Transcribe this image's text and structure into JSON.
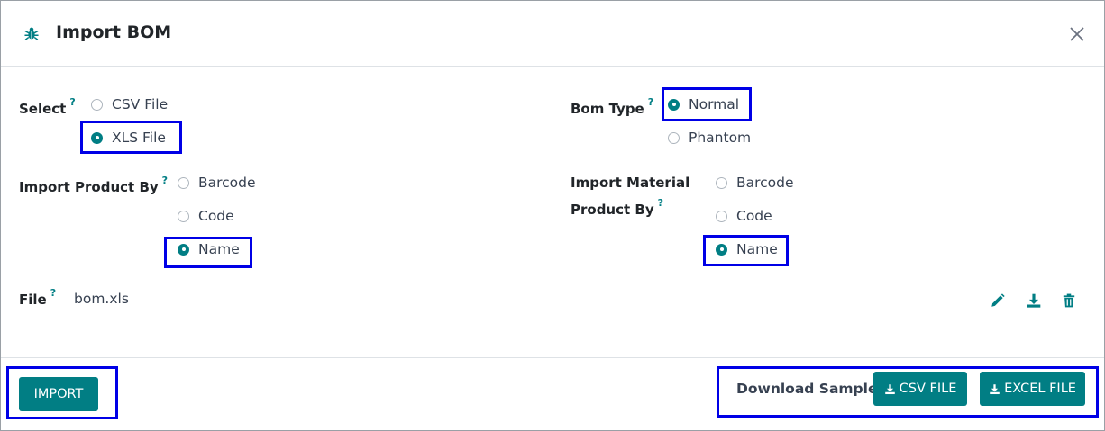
{
  "dialog": {
    "title": "Import BOM",
    "icon": "bug-icon",
    "close_icon": "close-icon"
  },
  "form": {
    "select": {
      "label": "Select",
      "help": "?",
      "options": [
        "CSV File",
        "XLS File"
      ],
      "selected": "XLS File"
    },
    "bom_type": {
      "label": "Bom Type",
      "help": "?",
      "options": [
        "Normal",
        "Phantom"
      ],
      "selected": "Normal"
    },
    "import_product_by": {
      "label": "Import Product By",
      "help": "?",
      "options": [
        "Barcode",
        "Code",
        "Name"
      ],
      "selected": "Name"
    },
    "import_material_product_by": {
      "label_line1": "Import Material",
      "label_line2": "Product By",
      "help": "?",
      "options": [
        "Barcode",
        "Code",
        "Name"
      ],
      "selected": "Name"
    },
    "file": {
      "label": "File",
      "help": "?",
      "value": "bom.xls",
      "actions": [
        "pencil-icon",
        "download-icon",
        "trash-icon"
      ]
    }
  },
  "footer": {
    "import_label": "IMPORT",
    "download_sample_label": "Download Sample:",
    "csv_button": "CSV FILE",
    "excel_button": "EXCEL FILE"
  },
  "colors": {
    "accent": "#017e84",
    "highlight": "#0000e6"
  }
}
